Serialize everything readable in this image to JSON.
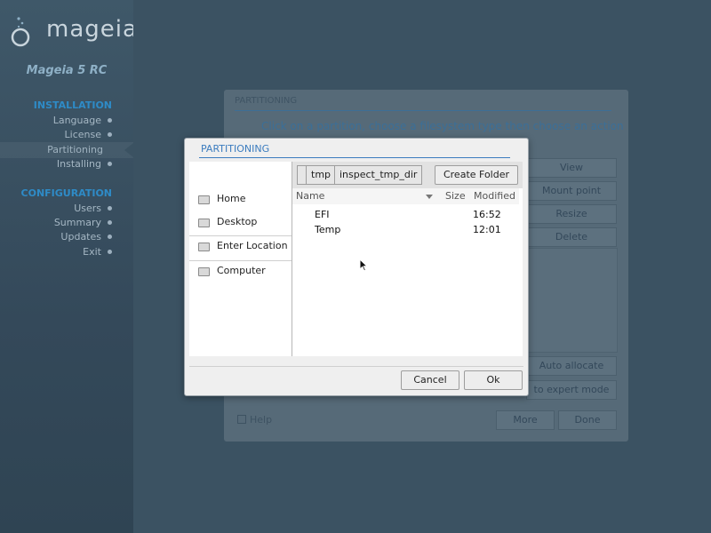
{
  "sidebar": {
    "logo_text": "mageia",
    "release": "Mageia 5 RC",
    "installation_heading": "INSTALLATION",
    "installation_steps": [
      "Language",
      "License",
      "Partitioning",
      "Installing"
    ],
    "configuration_heading": "CONFIGURATION",
    "configuration_steps": [
      "Users",
      "Summary",
      "Updates",
      "Exit"
    ],
    "active_step": "Partitioning"
  },
  "background": {
    "panel_title": "PARTITIONING",
    "hint": "Click on a partition, choose a filesystem type then choose an action",
    "buttons": [
      "View",
      "Mount point",
      "Resize",
      "Delete",
      "Auto allocate",
      "to expert mode"
    ],
    "help_label": "Help",
    "more_label": "More",
    "done_label": "Done"
  },
  "dialog": {
    "title": "PARTITIONING",
    "places": [
      "Home",
      "Desktop",
      "Enter Location",
      "Computer"
    ],
    "path": [
      "tmp",
      "inspect_tmp_dir"
    ],
    "create_folder_label": "Create Folder",
    "columns": {
      "name": "Name",
      "size": "Size",
      "modified": "Modified"
    },
    "files": [
      {
        "name": "EFI",
        "size": "",
        "modified": "16:52"
      },
      {
        "name": "Temp",
        "size": "",
        "modified": "12:01"
      }
    ],
    "cancel_label": "Cancel",
    "ok_label": "Ok"
  },
  "colors": {
    "accent": "#3b7cbf",
    "sidebar_heading": "#2e8bc7",
    "background": "#3b5262"
  }
}
